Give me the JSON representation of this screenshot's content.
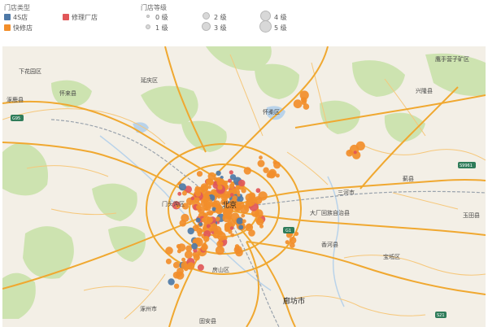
{
  "legend": {
    "type_title": "门店类型",
    "types": [
      {
        "label": "4S店",
        "color": "#4e79a7"
      },
      {
        "label": "修理厂店",
        "color": "#e15759"
      },
      {
        "label": "快修店",
        "color": "#f28e2b"
      }
    ],
    "level_title": "门店等级",
    "levels": [
      "0 级",
      "1 级",
      "2 级",
      "3 级",
      "4 级",
      "5 级"
    ]
  },
  "map": {
    "places": [
      {
        "name": "下花园区"
      },
      {
        "name": "涿鹿县"
      },
      {
        "name": "怀来县"
      },
      {
        "name": "延庆区"
      },
      {
        "name": "怀柔区"
      },
      {
        "name": "鹰手营子矿区"
      },
      {
        "name": "兴隆县"
      },
      {
        "name": "门头沟区"
      },
      {
        "name": "大厂回族自治县"
      },
      {
        "name": "三河市"
      },
      {
        "name": "蓟县"
      },
      {
        "name": "玉田县"
      },
      {
        "name": "香河县"
      },
      {
        "name": "宝坻区"
      },
      {
        "name": "涿州市"
      },
      {
        "name": "固安县"
      },
      {
        "name": "廊坊市"
      },
      {
        "name": "房山区"
      },
      {
        "name": "北京"
      }
    ],
    "shields": [
      "G95",
      "S9961",
      "G1",
      "S21"
    ]
  },
  "colors": {
    "water": "#b9d3ea",
    "park": "#cde3b0",
    "road": "#f0a830",
    "road_minor": "#f6c77a",
    "land": "#f3efe6"
  }
}
